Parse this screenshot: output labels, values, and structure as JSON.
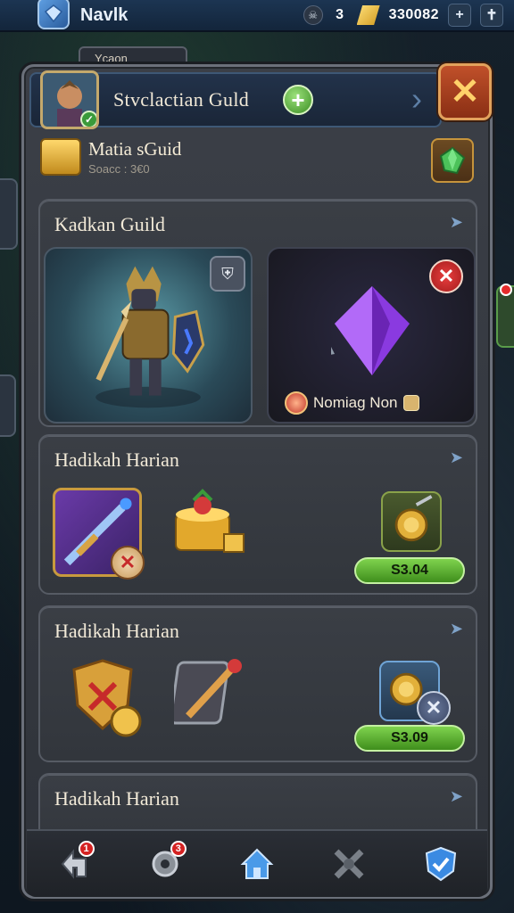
{
  "topbar": {
    "player_name": "Navlk",
    "resource_count": "3",
    "gold_amount": "330082",
    "plus_label": "+",
    "cross_label": "✝"
  },
  "back_tab": {
    "label": "Ycaon"
  },
  "panel": {
    "title": "Stvclactian Guld",
    "close_symbol": "✕",
    "add_symbol": "+"
  },
  "guild_header": {
    "name": "Matia sGuid",
    "subtitle": "Soacc : 3€0"
  },
  "sections": [
    {
      "title": "Kadkan Guild",
      "right_card": {
        "label": "Nomiag Non"
      }
    },
    {
      "title": "Hadikah Harian",
      "price": "S3.04"
    },
    {
      "title": "Hadikah Harian",
      "price": "S3.09"
    },
    {
      "title": "Hadikah Harian"
    }
  ],
  "bottom_nav": {
    "badge_1": "1",
    "badge_2": "3"
  },
  "colors": {
    "panel_bg": "#34383f",
    "accent_green": "#5bbf2e",
    "close_red": "#b24422",
    "title_bar": "#1e2c42"
  },
  "icons": [
    "gem-icon",
    "skull-icon",
    "gold-bar-icon",
    "plus-icon",
    "cross-icon",
    "chest-icon",
    "emerald-icon",
    "crystal-icon",
    "sword-icon",
    "cake-icon",
    "shield-icon",
    "dagger-icon",
    "home-icon",
    "checkmark-icon"
  ]
}
